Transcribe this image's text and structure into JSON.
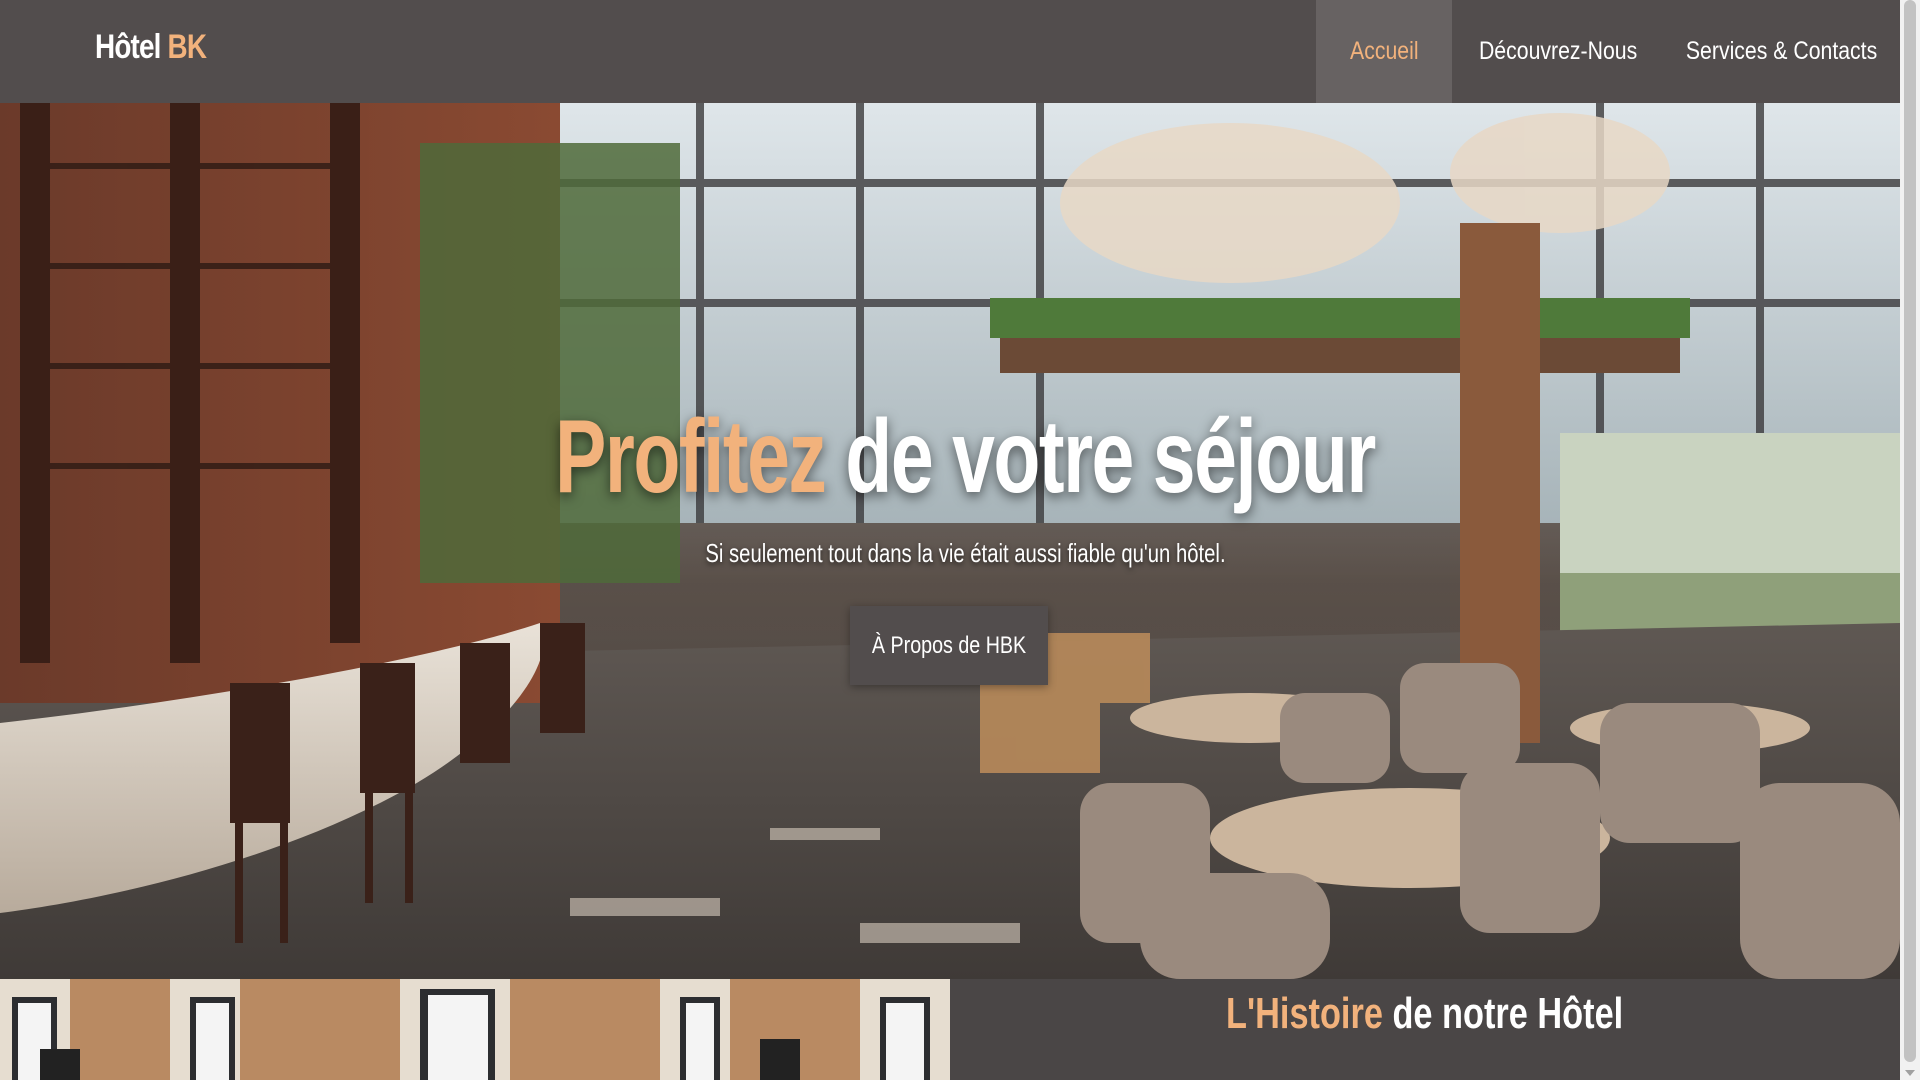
{
  "brand": {
    "name": "Hôtel",
    "accent": "BK"
  },
  "nav": {
    "items": [
      {
        "label": "Accueil",
        "active": true
      },
      {
        "label": "Découvrez-Nous",
        "active": false
      },
      {
        "label": "Services & Contacts",
        "active": false
      }
    ]
  },
  "hero": {
    "title_accent": "Profitez",
    "title_rest": "de votre séjour",
    "subtitle": "Si seulement tout dans la vie était aussi fiable qu'un hôtel.",
    "button_label": "À Propos de HBK"
  },
  "history": {
    "title_accent": "L'Histoire",
    "title_rest": "de notre Hôtel"
  },
  "colors": {
    "accent": "#f2b27c",
    "nav_bg": "#524d4d",
    "nav_active_bg": "#676262",
    "section_bg": "#4a4646",
    "text": "#ffffff"
  }
}
